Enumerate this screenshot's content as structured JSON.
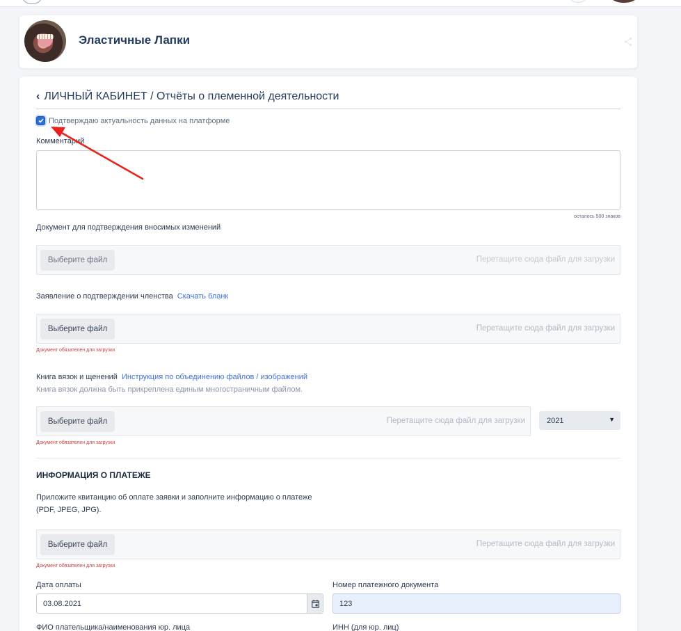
{
  "header": {
    "kennel_name": "Эластичные Лапки"
  },
  "page": {
    "back_symbol": "‹",
    "title": "ЛИЧНЫЙ КАБИНЕТ / Отчёты о племенной деятельности"
  },
  "confirm": {
    "checked": true,
    "label": "Подтверждаю актуальность данных на платформе"
  },
  "comment": {
    "label": "Комментарий",
    "value": "",
    "counter": "осталось 500 знаков"
  },
  "upload_common": {
    "button_label": "Выберите файл",
    "drop_text": "Перетащите сюда файл для загрузки",
    "required_error": "Документ обязателен для загрузки"
  },
  "doc_changes": {
    "label": "Документ для подтверждения вносимых изменений"
  },
  "membership": {
    "label": "Заявление о подтверждении членства",
    "link": "Скачать бланк"
  },
  "mating_book": {
    "label": "Книга вязок и щенений",
    "link": "Инструкция по объединению файлов / изображений",
    "hint": "Книга вязок должна быть прикреплена единым многостраничным файлом.",
    "year": "2021"
  },
  "payment": {
    "section_title": "ИНФОРМАЦИЯ О ПЛАТЕЖЕ",
    "desc_line1": "Приложите квитанцию об оплате заявки и заполните информацию о платеже",
    "desc_line2": "(PDF, JPEG, JPG).",
    "date_label": "Дата оплаты",
    "date_value": "03.08.2021",
    "doc_number_label": "Номер платежного документа",
    "doc_number_value": "123",
    "payer_label": "ФИО плательщика/наименования юр. лица",
    "inn_label": "ИНН (для юр. лиц)"
  },
  "colors": {
    "accent": "#2a6fd6",
    "link": "#3f6fd8",
    "error": "#d43c3c",
    "annotation_arrow": "#e8231f"
  }
}
